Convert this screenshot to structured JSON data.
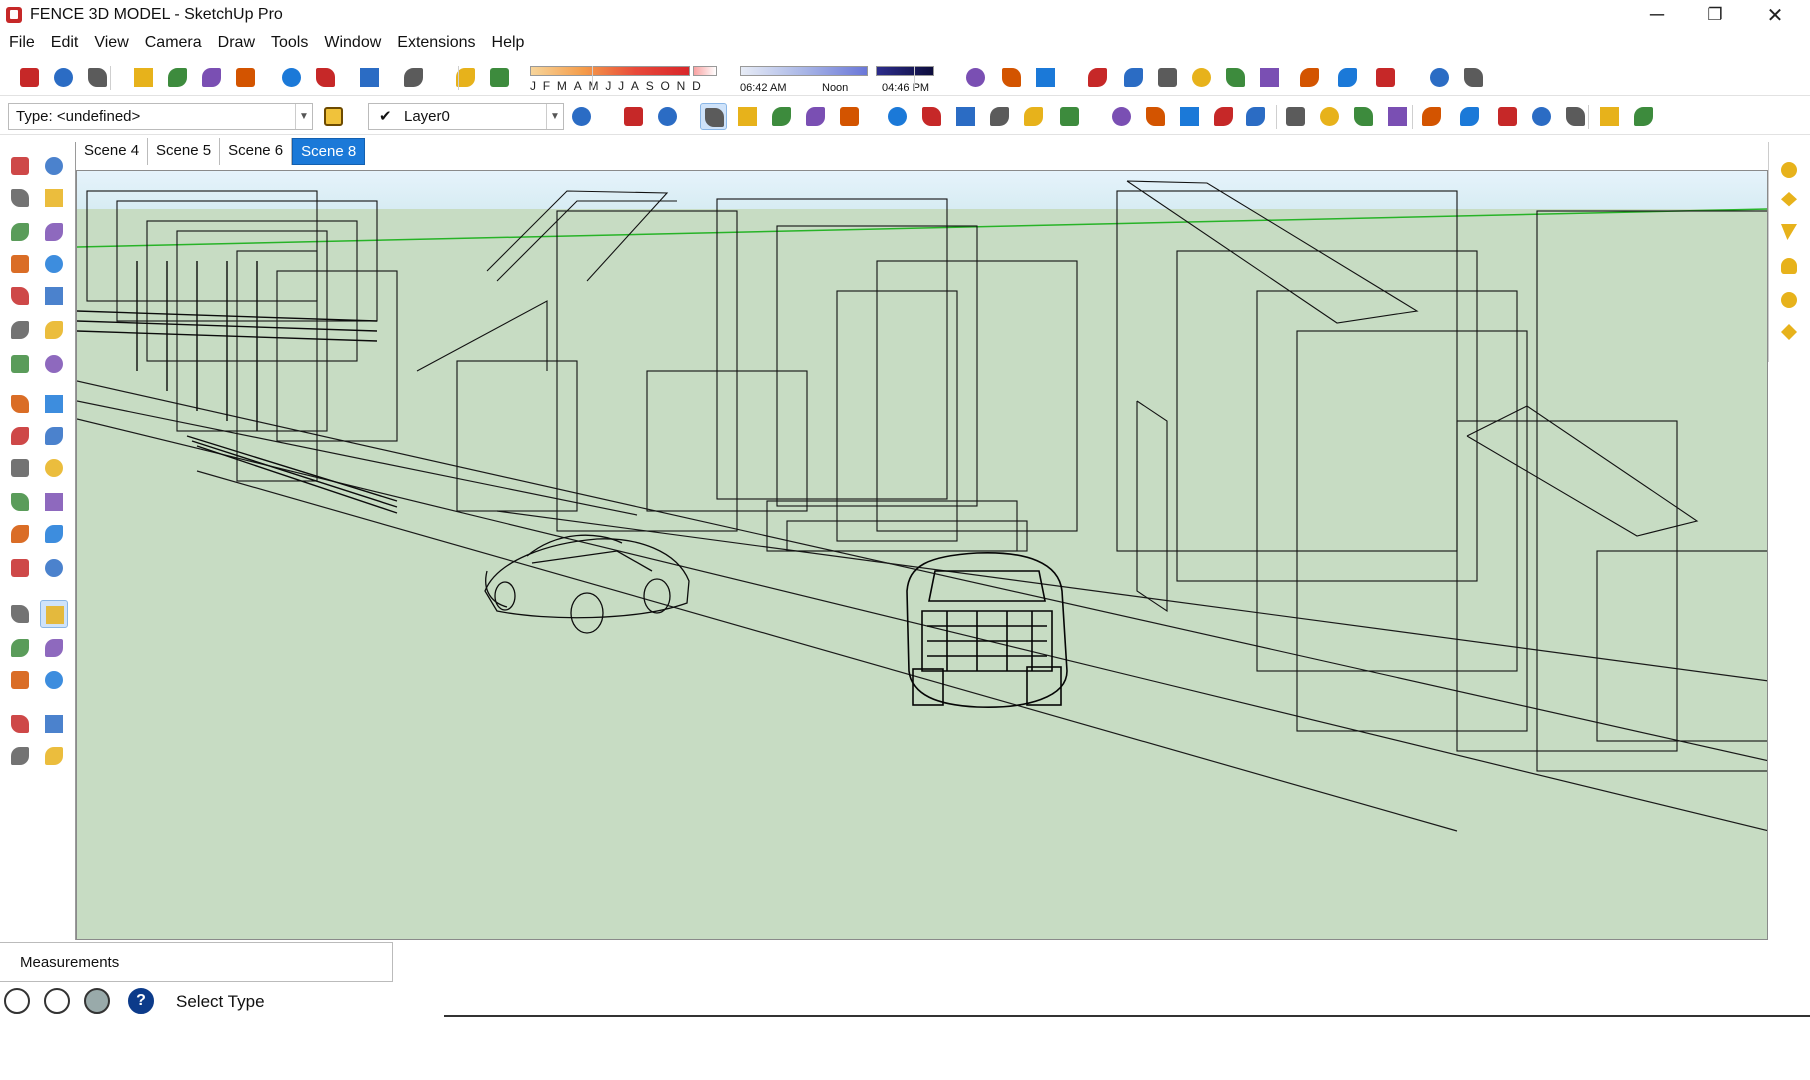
{
  "window": {
    "title": "FENCE 3D MODEL - SketchUp Pro",
    "controls": {
      "minimize": "─",
      "restore": "❐",
      "close": "✕"
    }
  },
  "menu": [
    "File",
    "Edit",
    "View",
    "Camera",
    "Draw",
    "Tools",
    "Window",
    "Extensions",
    "Help"
  ],
  "shadows": {
    "months": "JFMAMJJASOND",
    "sunrise": "06:42 AM",
    "noon": "Noon",
    "sunset": "04:46 PM"
  },
  "type_selector": {
    "value": "Type: <undefined>"
  },
  "layer_selector": {
    "check": "✔",
    "value": "Layer0"
  },
  "scene_tabs": [
    {
      "label": "Scene 4",
      "active": false
    },
    {
      "label": "Scene 5",
      "active": false
    },
    {
      "label": "Scene 6",
      "active": false
    },
    {
      "label": "Scene 8",
      "active": true
    }
  ],
  "measurements": {
    "label": "Measurements"
  },
  "status": {
    "text": "Select Type",
    "help_glyph": "?"
  },
  "icons": {
    "toolbar1": [
      "new-file-icon",
      "open-icon",
      "save-icon",
      "cut-icon",
      "copy-icon",
      "paste-icon",
      "erase-icon",
      "undo-icon",
      "redo-icon",
      "print-icon",
      "model-info-icon",
      "shadows-toggle-icon",
      "fog-toggle-icon",
      "warehouse-icon",
      "share-model-icon",
      "extension-warehouse-icon",
      "orbit-camera-icon",
      "section-plane-icon",
      "section-fill-icon",
      "display-section-icon",
      "display-cuts-icon",
      "dimension-icon",
      "solid-union-icon",
      "solid-subtract-icon",
      "solid-trim-icon",
      "solid-split-icon",
      "outer-shell-icon"
    ],
    "toolbar2": [
      "xray-icon",
      "back-edges-icon",
      "wireframe-icon",
      "hidden-line-icon",
      "shaded-icon",
      "shaded-textures-icon",
      "monochrome-icon",
      "iso-view-icon",
      "top-view-icon",
      "front-view-icon",
      "right-view-icon",
      "back-view-icon",
      "left-view-icon",
      "sandbox-from-contours-icon",
      "sandbox-scratch-icon",
      "smoove-icon",
      "stamp-icon",
      "drape-icon",
      "add-detail-icon",
      "flip-edge-icon",
      "dynamic-components-icon",
      "interact-icon",
      "component-options-icon",
      "component-attributes-icon",
      "ruby-console-icon",
      "trimble-connect-icon",
      "location-icon",
      "photo-texture-icon",
      "add-location-icon"
    ]
  },
  "colors": {
    "viewport_bg": "#c7dcc3",
    "active_tab": "#1b79d8",
    "accent_red": "#c62828",
    "horizon_green": "#27b327"
  }
}
